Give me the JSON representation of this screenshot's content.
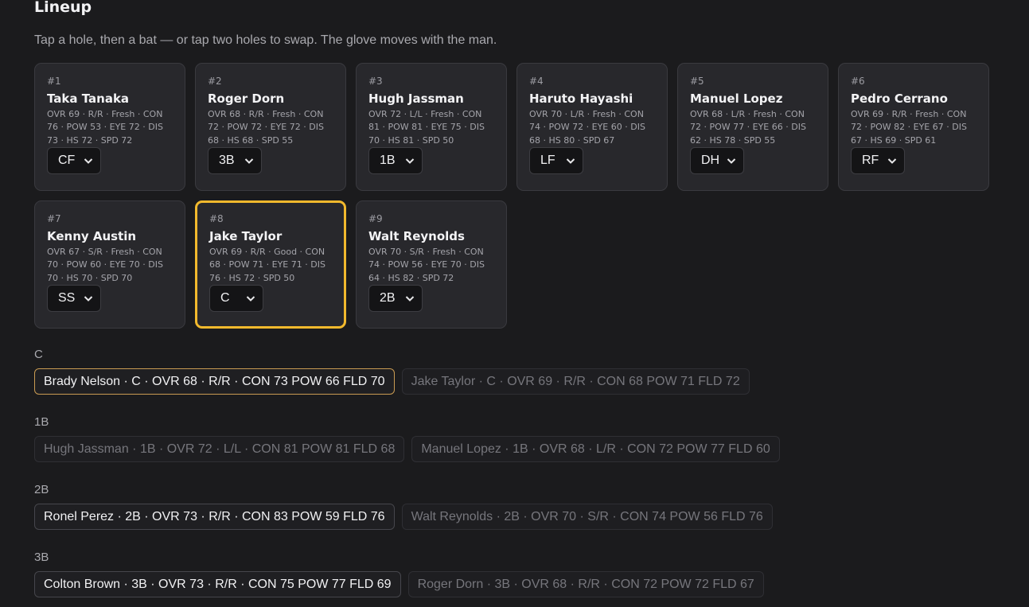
{
  "header": {
    "title": "Lineup",
    "subtitle": "Tap a hole, then a bat — or tap two holes to swap. The glove moves with the man."
  },
  "lineup": [
    {
      "num": "#1",
      "name": "Taka Tanaka",
      "stats": "OVR 69 · R/R · Fresh · CON 76 · POW 53 · EYE 72 · DIS 73 · HS 72 · SPD 72",
      "pos": "CF"
    },
    {
      "num": "#2",
      "name": "Roger Dorn",
      "stats": "OVR 68 · R/R · Fresh · CON 72 · POW 72 · EYE 72 · DIS 68 · HS 68 · SPD 55",
      "pos": "3B"
    },
    {
      "num": "#3",
      "name": "Hugh Jassman",
      "stats": "OVR 72 · L/L · Fresh · CON 81 · POW 81 · EYE 75 · DIS 70 · HS 81 · SPD 50",
      "pos": "1B"
    },
    {
      "num": "#4",
      "name": "Haruto Hayashi",
      "stats": "OVR 70 · L/R · Fresh · CON 74 · POW 72 · EYE 60 · DIS 68 · HS 80 · SPD 67",
      "pos": "LF"
    },
    {
      "num": "#5",
      "name": "Manuel Lopez",
      "stats": "OVR 68 · L/R · Fresh · CON 72 · POW 77 · EYE 66 · DIS 62 · HS 78 · SPD 55",
      "pos": "DH"
    },
    {
      "num": "#6",
      "name": "Pedro Cerrano",
      "stats": "OVR 69 · R/R · Fresh · CON 72 · POW 82 · EYE 67 · DIS 67 · HS 69 · SPD 61",
      "pos": "RF"
    },
    {
      "num": "#7",
      "name": "Kenny Austin",
      "stats": "OVR 67 · S/R · Fresh · CON 70 · POW 60 · EYE 70 · DIS 70 · HS 70 · SPD 70",
      "pos": "SS"
    },
    {
      "num": "#8",
      "name": "Jake Taylor",
      "stats": "OVR 69 · R/R · Good · CON 68 · POW 71 · EYE 71 · DIS 76 · HS 72 · SPD 50",
      "pos": "C"
    },
    {
      "num": "#9",
      "name": "Walt Reynolds",
      "stats": "OVR 70 · S/R · Fresh · CON 74 · POW 56 · EYE 70 · DIS 64 · HS 82 · SPD 72",
      "pos": "2B"
    }
  ],
  "bench_groups": [
    {
      "label": "C",
      "chips": [
        {
          "text": "Brady Nelson · C · OVR 68 · R/R · CON 73 POW 66 FLD 70",
          "state": "current"
        },
        {
          "text": "Jake Taylor · C · OVR 69 · R/R · CON 68 POW 71 FLD 72",
          "state": "dim"
        }
      ]
    },
    {
      "label": "1B",
      "chips": [
        {
          "text": "Hugh Jassman · 1B · OVR 72 · L/L · CON 81 POW 81 FLD 68",
          "state": "dim"
        },
        {
          "text": "Manuel Lopez · 1B · OVR 68 · L/R · CON 72 POW 77 FLD 60",
          "state": "dim"
        }
      ]
    },
    {
      "label": "2B",
      "chips": [
        {
          "text": "Ronel Perez · 2B · OVR 73 · R/R · CON 83 POW 59 FLD 76",
          "state": "active"
        },
        {
          "text": "Walt Reynolds · 2B · OVR 70 · S/R · CON 74 POW 56 FLD 76",
          "state": "dim"
        }
      ]
    },
    {
      "label": "3B",
      "chips": [
        {
          "text": "Colton Brown · 3B · OVR 73 · R/R · CON 75 POW 77 FLD 69",
          "state": "active"
        },
        {
          "text": "Roger Dorn · 3B · OVR 68 · R/R · CON 72 POW 72 FLD 67",
          "state": "dim"
        }
      ]
    }
  ],
  "selected_slot": "#8",
  "colors": {
    "accent": "#f2b92d",
    "background": "#1b1b1d",
    "card": "#28282c"
  },
  "icons": {
    "select_arrow": "chevron-down-icon"
  }
}
